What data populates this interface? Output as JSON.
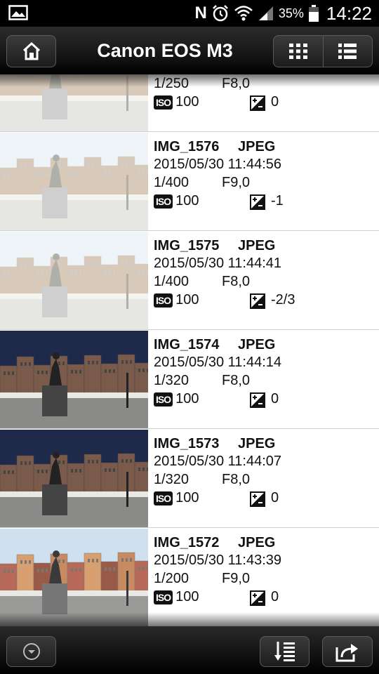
{
  "status_bar": {
    "battery_percent": "35%",
    "time": "14:22",
    "icons": [
      "picture-icon",
      "nfc-icon",
      "alarm-icon",
      "wifi-icon",
      "signal-icon",
      "battery-icon"
    ],
    "nfc_letter": "N"
  },
  "header": {
    "title": "Canon EOS M3",
    "home_icon": "home-icon",
    "view_grid_icon": "grid-view-icon",
    "view_list_icon": "list-view-icon"
  },
  "images": [
    {
      "name": "",
      "format": "",
      "datetime": "",
      "shutter": "1/250",
      "aperture": "F8,0",
      "iso_label": "ISO",
      "iso": "100",
      "exposure_comp": "0",
      "thumb_style": "bright"
    },
    {
      "name": "IMG_1576",
      "format": "JPEG",
      "datetime": "2015/05/30 11:44:56",
      "shutter": "1/400",
      "aperture": "F9,0",
      "iso_label": "ISO",
      "iso": "100",
      "exposure_comp": "-1",
      "thumb_style": "bright"
    },
    {
      "name": "IMG_1575",
      "format": "JPEG",
      "datetime": "2015/05/30 11:44:41",
      "shutter": "1/400",
      "aperture": "F8,0",
      "iso_label": "ISO",
      "iso": "100",
      "exposure_comp": "-2/3",
      "thumb_style": "bright"
    },
    {
      "name": "IMG_1574",
      "format": "JPEG",
      "datetime": "2015/05/30 11:44:14",
      "shutter": "1/320",
      "aperture": "F8,0",
      "iso_label": "ISO",
      "iso": "100",
      "exposure_comp": "0",
      "thumb_style": "dark"
    },
    {
      "name": "IMG_1573",
      "format": "JPEG",
      "datetime": "2015/05/30 11:44:07",
      "shutter": "1/320",
      "aperture": "F8,0",
      "iso_label": "ISO",
      "iso": "100",
      "exposure_comp": "0",
      "thumb_style": "dark"
    },
    {
      "name": "IMG_1572",
      "format": "JPEG",
      "datetime": "2015/05/30 11:43:39",
      "shutter": "1/200",
      "aperture": "F9,0",
      "iso_label": "ISO",
      "iso": "100",
      "exposure_comp": "0",
      "thumb_style": "closeup"
    }
  ],
  "footer": {
    "icons": [
      "chevron-down-circle-icon",
      "sort-order-icon",
      "share-icon"
    ]
  }
}
